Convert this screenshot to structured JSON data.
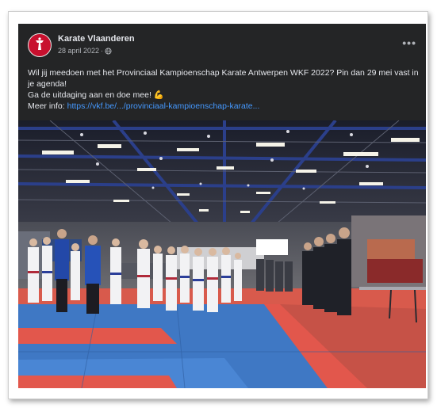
{
  "post": {
    "page_name": "Karate Vlaanderen",
    "date": "28 april 2022",
    "separator": "·",
    "audience_icon": "globe-icon",
    "more_icon": "more-options-icon",
    "text_line1": "Wil jij meedoen met het Provinciaal Kampioenschap Karate Antwerpen WKF 2022? Pin dan 29 mei vast in je agenda!",
    "text_line2": "Ga de uitdaging aan en doe mee! 💪",
    "more_info_label": "Meer info: ",
    "link_text": "https://vkf.be/.../provinciaal-kampioenschap-karate...",
    "photo_icon": "sports-hall-photo"
  },
  "colors": {
    "card_bg": "#242526",
    "text_primary": "#e4e6eb",
    "text_secondary": "#b0b3b8",
    "link": "#4599ff",
    "avatar_red": "#c8102e",
    "mat_blue": "#3f78c4",
    "mat_red": "#e2574c"
  }
}
